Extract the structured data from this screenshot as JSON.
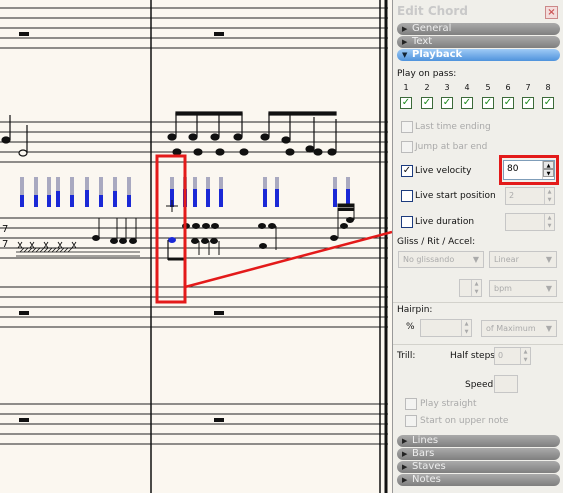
{
  "panel": {
    "title": "Edit Chord",
    "close_icon": "close-icon",
    "sections": [
      {
        "label": "General",
        "state": "collapsed"
      },
      {
        "label": "Text",
        "state": "collapsed"
      },
      {
        "label": "Playback",
        "state": "expanded"
      },
      {
        "label": "Lines",
        "state": "collapsed"
      },
      {
        "label": "Bars",
        "state": "collapsed"
      },
      {
        "label": "Staves",
        "state": "collapsed"
      },
      {
        "label": "Notes",
        "state": "collapsed"
      }
    ],
    "playback": {
      "play_on_pass_label": "Play on pass:",
      "passes": [
        "1",
        "2",
        "3",
        "4",
        "5",
        "6",
        "7",
        "8"
      ],
      "passes_checked": [
        true,
        true,
        true,
        true,
        true,
        true,
        true,
        true
      ],
      "last_time_ending": "Last time ending",
      "jump_at_bar_end": "Jump at bar end",
      "live_velocity": "Live velocity",
      "live_velocity_checked": true,
      "live_velocity_value": "80",
      "live_start_position": "Live start position",
      "live_start_position_value": "2",
      "live_duration": "Live duration",
      "gliss_label": "Gliss / Rit / Accel:",
      "gliss_value": "No glissando",
      "curve_value": "Linear",
      "unit_value": "bpm",
      "hairpin_label": "Hairpin:",
      "percent_label": "%",
      "of_max_value": "of Maximum",
      "trill_label": "Trill:",
      "half_steps_label": "Half steps",
      "half_steps_value": "0",
      "speed_label": "Speed",
      "play_straight": "Play straight",
      "start_on_upper": "Start on upper note"
    }
  },
  "colors": {
    "highlight": "#e31a1a",
    "velocity_bar": "#1a28d6",
    "velocity_track": "#a9a9c0",
    "section_active": "#4f93dc",
    "section_inactive": "#8b8b8b"
  }
}
